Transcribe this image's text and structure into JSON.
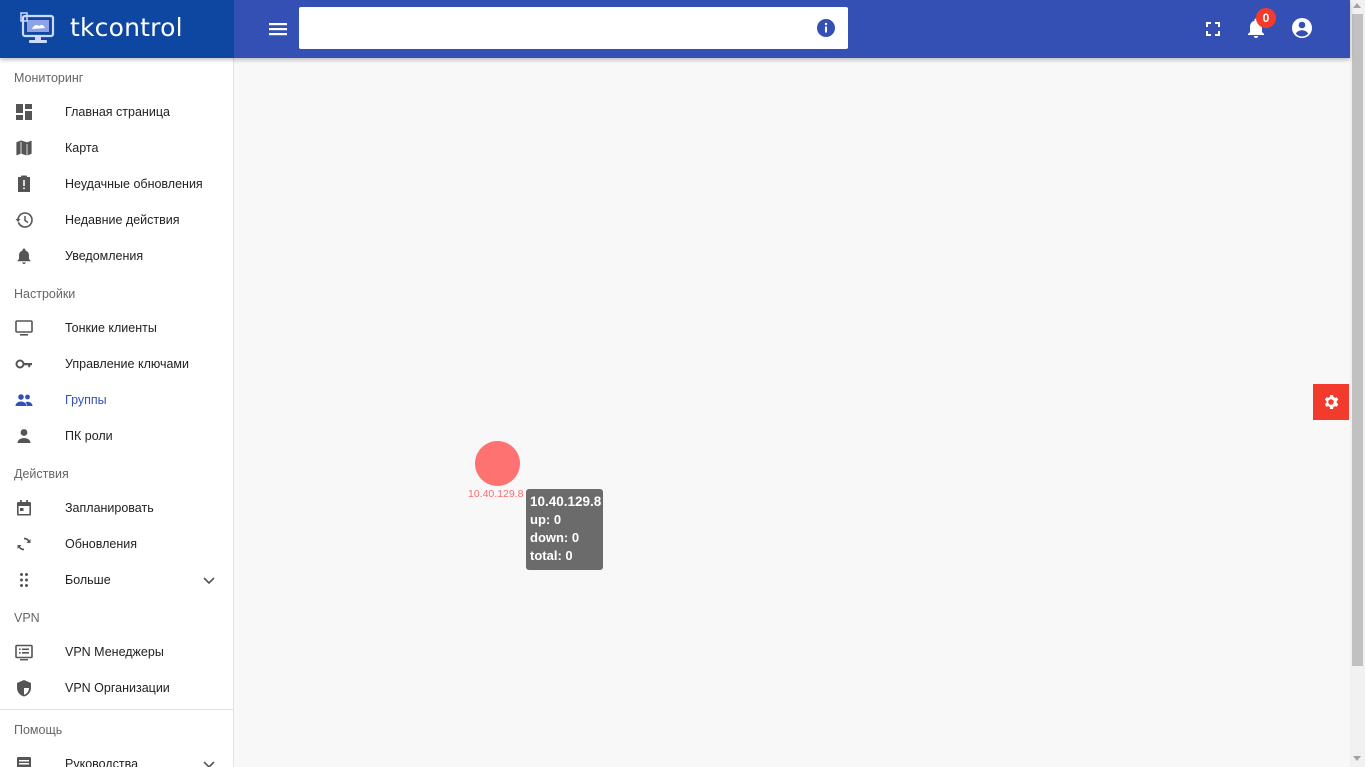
{
  "app": {
    "name": "tkcontrol"
  },
  "header": {
    "search": {
      "value": "",
      "placeholder": ""
    },
    "notifications_count": "0",
    "colors": {
      "bar": "#3450b5",
      "brand": "#0d47a1",
      "badge": "#f23b2d"
    }
  },
  "sidebar": {
    "sections": [
      {
        "title": "Мониторинг",
        "items": [
          {
            "label": "Главная страница",
            "icon": "dashboard-icon"
          },
          {
            "label": "Карта",
            "icon": "map-icon"
          },
          {
            "label": "Неудачные обновления",
            "icon": "clipboard-alert-icon"
          },
          {
            "label": "Недавние действия",
            "icon": "history-icon"
          },
          {
            "label": "Уведомления",
            "icon": "bell-icon"
          }
        ]
      },
      {
        "title": "Настройки",
        "items": [
          {
            "label": "Тонкие клиенты",
            "icon": "monitor-icon"
          },
          {
            "label": "Управление ключами",
            "icon": "key-icon"
          },
          {
            "label": "Группы",
            "icon": "people-icon",
            "active": true
          },
          {
            "label": "ПК роли",
            "icon": "person-icon"
          }
        ]
      },
      {
        "title": "Действия",
        "items": [
          {
            "label": "Запланировать",
            "icon": "calendar-icon"
          },
          {
            "label": "Обновления",
            "icon": "sync-icon"
          },
          {
            "label": "Больше",
            "icon": "dots-grid-icon",
            "expandable": true
          }
        ]
      },
      {
        "title": "VPN",
        "items": [
          {
            "label": "VPN Менеджеры",
            "icon": "list-box-icon"
          },
          {
            "label": "VPN Организации",
            "icon": "shield-icon"
          }
        ]
      },
      {
        "title": "Помощь",
        "items": [
          {
            "label": "Руководства",
            "icon": "book-icon",
            "expandable": true
          }
        ]
      }
    ]
  },
  "graph": {
    "node": {
      "label": "10.40.129.8",
      "color": "#ff7272"
    },
    "tooltip": {
      "title": "10.40.129.8",
      "up": "up: 0",
      "down": "down: 0",
      "total": "total: 0"
    }
  },
  "settings_tab": {
    "icon": "gear-icon",
    "color": "#f23b2d"
  }
}
